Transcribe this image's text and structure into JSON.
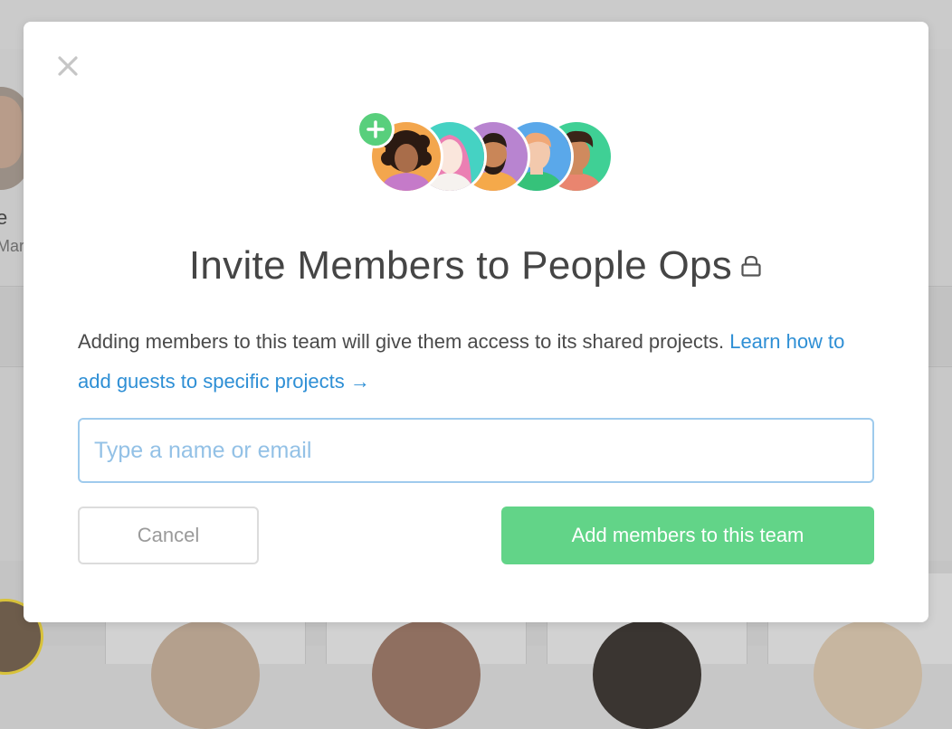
{
  "modal": {
    "title": "Invite Members to People Ops",
    "description": "Adding members to this team will give them access to its shared projects. ",
    "learn_link_text": "Learn how to add guests to specific projects →",
    "input": {
      "placeholder": "Type a name or email",
      "value": ""
    },
    "cancel_label": "Cancel",
    "submit_label": "Add members to this team",
    "icons": {
      "close": "close-icon",
      "lock": "lock-icon",
      "plus": "plus-icon"
    }
  },
  "background": {
    "text_line_1": "e",
    "text_line_2": "Mar"
  },
  "colors": {
    "accent_green": "#62d488",
    "link_blue": "#2e8fd5",
    "input_border": "#9fcbed",
    "title_text": "#454545"
  }
}
